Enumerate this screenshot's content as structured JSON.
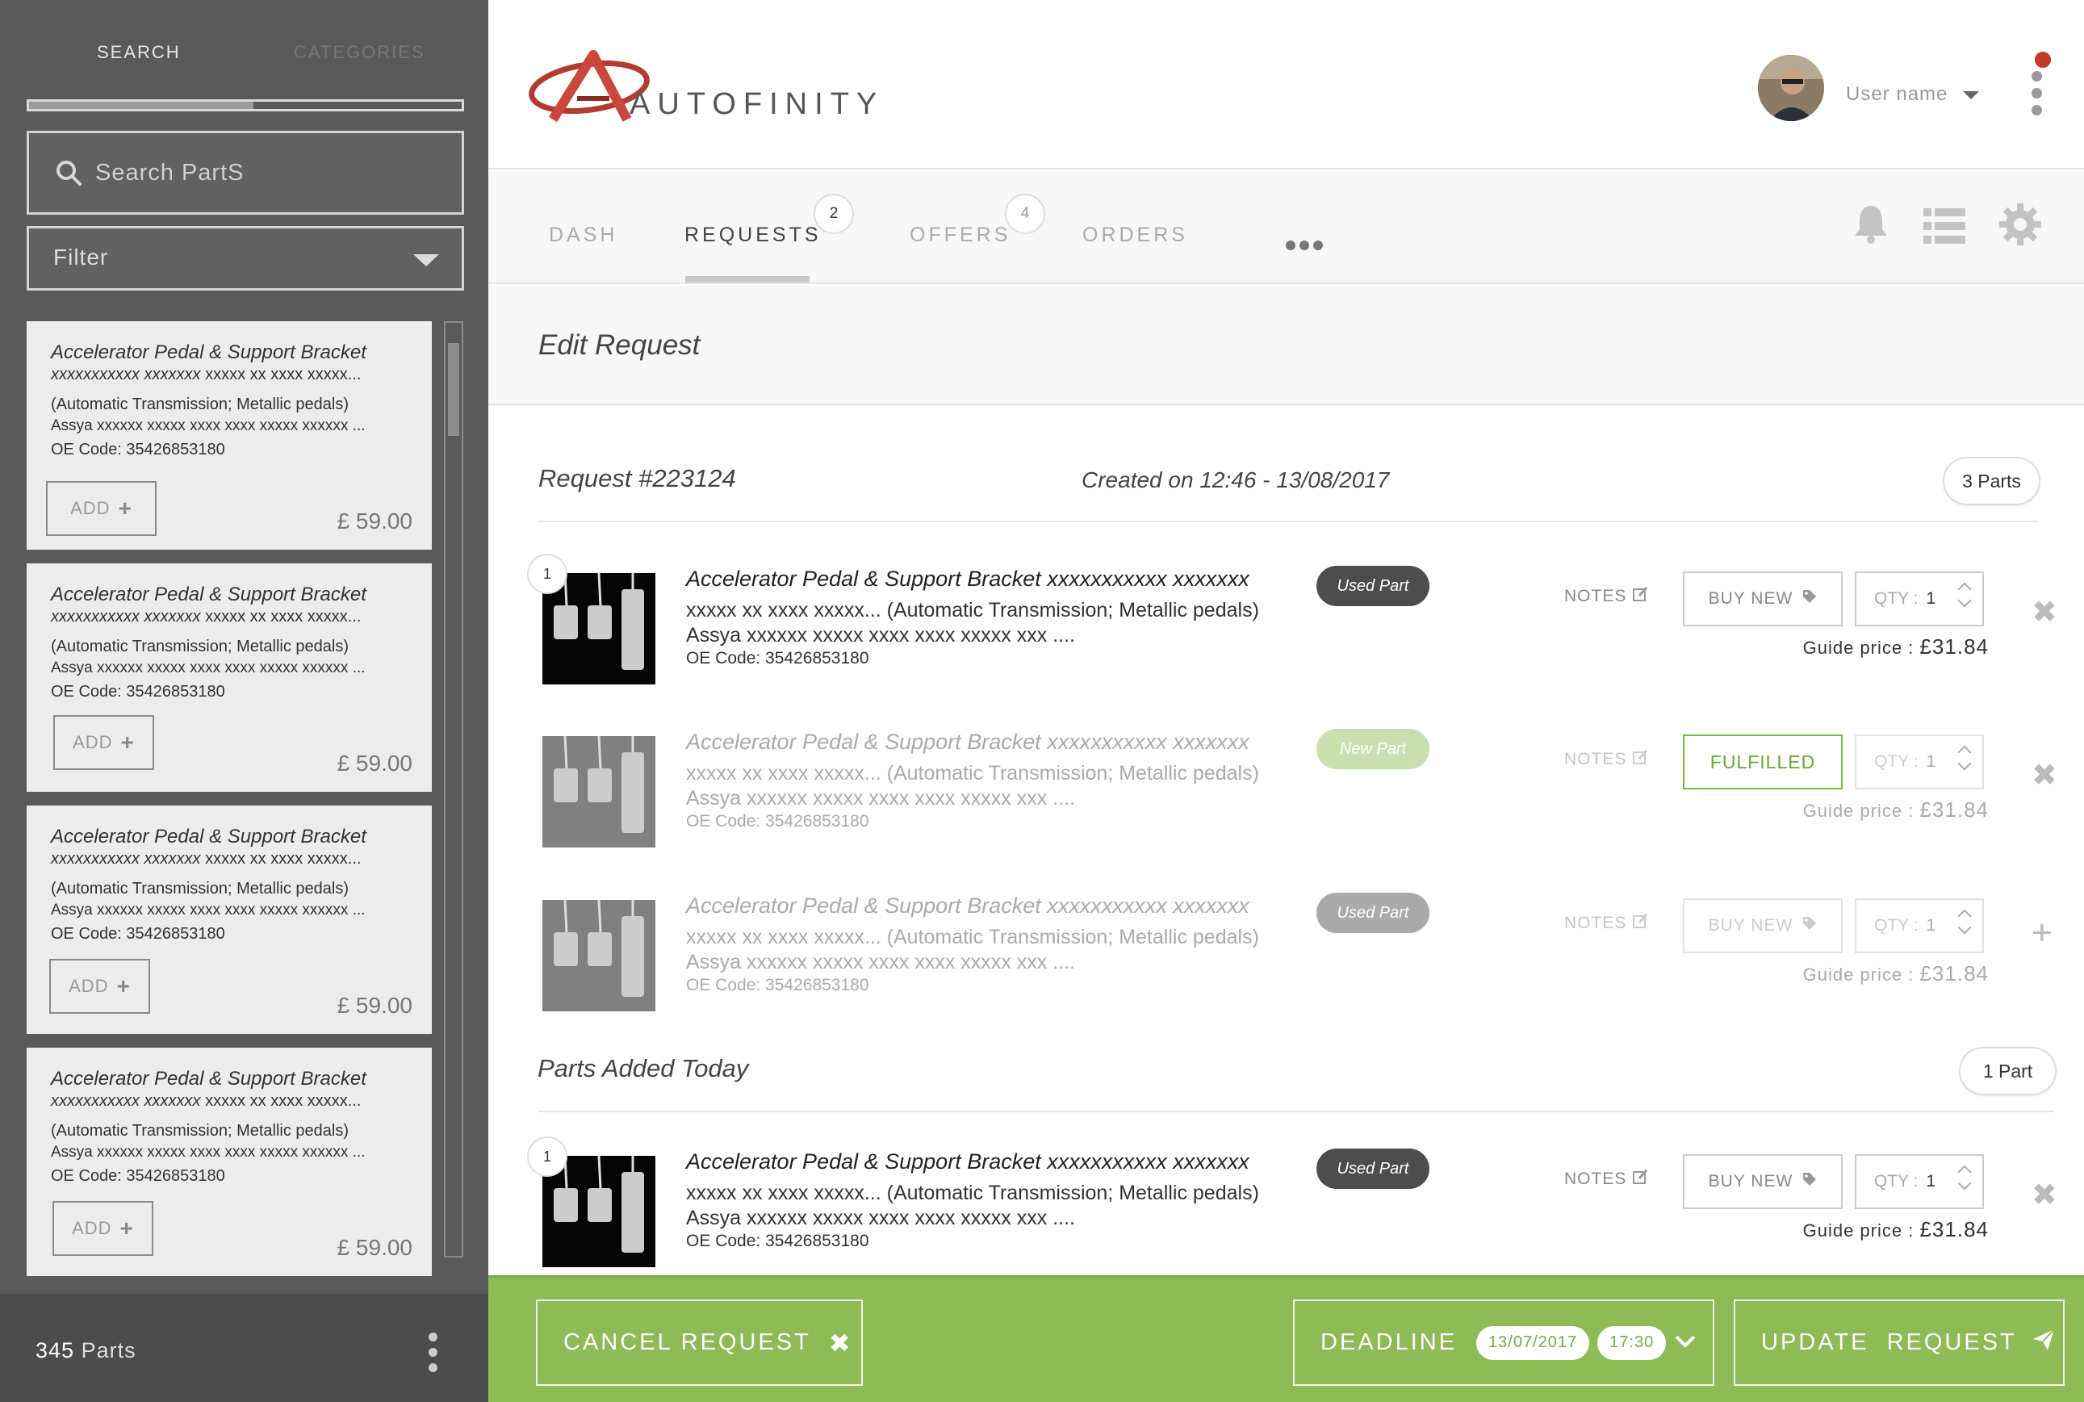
{
  "sidebar": {
    "tabs": {
      "search": "SEARCH",
      "categories": "CATEGORIES"
    },
    "search_placeholder": "Search PartS",
    "filter_label": "Filter",
    "parts": [
      {
        "title": "Accelerator Pedal & Support Bracket",
        "line2_bold": "xxxxxxxxxxx xxxxxxx",
        "line2_rest": " xxxxx xx xxxx xxxxx...",
        "line3": "(Automatic Transmission; Metallic pedals)",
        "line4": "Assya xxxxxx xxxxx xxxx xxxx xxxxx xxxxxx ...",
        "oe": "OE Code: 35426853180",
        "add_label": "ADD",
        "price": "£  59.00"
      },
      {
        "title": "Accelerator Pedal & Support Bracket",
        "line2_bold": "xxxxxxxxxxx xxxxxxx",
        "line2_rest": " xxxxx xx xxxx xxxxx...",
        "line3": "(Automatic Transmission; Metallic pedals)",
        "line4": "Assya xxxxxx xxxxx xxxx xxxx xxxxx xxxxxx ...",
        "oe": "OE Code: 35426853180",
        "add_label": "ADD",
        "price": "£  59.00"
      },
      {
        "title": "Accelerator Pedal & Support Bracket",
        "line2_bold": "xxxxxxxxxxx xxxxxxx",
        "line2_rest": " xxxxx xx xxxx xxxxx...",
        "line3": "(Automatic Transmission; Metallic pedals)",
        "line4": "Assya xxxxxx xxxxx xxxx xxxx xxxxx xxxxxx ...",
        "oe": "OE Code: 35426853180",
        "add_label": "ADD",
        "price": "£  59.00"
      },
      {
        "title": "Accelerator Pedal & Support Bracket",
        "line2_bold": "xxxxxxxxxxx xxxxxxx",
        "line2_rest": " xxxxx xx xxxx xxxxx...",
        "line3": "(Automatic Transmission; Metallic pedals)",
        "line4": "Assya xxxxxx xxxxx xxxx xxxx xxxxx xxxxxx ...",
        "oe": "OE Code: 35426853180",
        "add_label": "ADD",
        "price": "£  59.00"
      }
    ],
    "footer": {
      "count_number": "345",
      "count_label": "Parts"
    }
  },
  "header": {
    "logo_text": "AUTOFINITY",
    "user_name": "User name"
  },
  "nav": {
    "tabs": [
      "DASH",
      "REQUESTS",
      "OFFERS",
      "ORDERS"
    ],
    "badges": {
      "requests": "2",
      "offers": "4"
    }
  },
  "edit": {
    "title": "Edit Request"
  },
  "request": {
    "id": "Request #223124",
    "created": "Created on 12:46 - 13/08/2017",
    "parts_count": "3 Parts",
    "items": [
      {
        "number": "1",
        "name": "Accelerator Pedal & Support Bracket xxxxxxxxxxx xxxxxxx",
        "desc1": "xxxxx xx xxxx xxxxx... (Automatic Transmission; Metallic pedals)",
        "desc2": "Assya xxxxxx xxxxx xxxx xxxx xxxxx xxx ....",
        "oe": "OE Code: 35426853180",
        "badge": "Used Part",
        "notes": "NOTES",
        "action": "BUY NEW",
        "qty_label": "QTY :",
        "qty": "1",
        "guide_label": "Guide price :",
        "guide_price": "£31.84"
      },
      {
        "name": "Accelerator Pedal & Support Bracket xxxxxxxxxxx xxxxxxx",
        "desc1": "xxxxx xx xxxx xxxxx... (Automatic Transmission; Metallic pedals)",
        "desc2": "Assya xxxxxx xxxxx xxxx xxxx xxxxx xxx ....",
        "oe": "OE Code: 35426853180",
        "badge": "New Part",
        "notes": "NOTES",
        "action": "FULFILLED",
        "qty_label": "QTY :",
        "qty": "1",
        "guide_label": "Guide price :",
        "guide_price": "£31.84"
      },
      {
        "name": "Accelerator Pedal & Support Bracket xxxxxxxxxxx xxxxxxx",
        "desc1": "xxxxx xx xxxx xxxxx... (Automatic Transmission; Metallic pedals)",
        "desc2": "Assya xxxxxx xxxxx xxxx xxxx xxxxx xxx ....",
        "oe": "OE Code: 35426853180",
        "badge": "Used Part",
        "notes": "NOTES",
        "action": "BUY NEW",
        "qty_label": "QTY :",
        "qty": "1",
        "guide_label": "Guide price :",
        "guide_price": "£31.84"
      }
    ]
  },
  "today": {
    "title": "Parts Added Today",
    "parts_count": "1 Part",
    "item": {
      "number": "1",
      "name": "Accelerator Pedal & Support Bracket xxxxxxxxxxx xxxxxxx",
      "desc1": "xxxxx xx xxxx xxxxx... (Automatic Transmission; Metallic pedals)",
      "desc2": "Assya xxxxxx xxxxx xxxx xxxx xxxxx xxx ....",
      "oe": "OE Code: 35426853180",
      "badge": "Used Part",
      "notes": "NOTES",
      "action": "BUY NEW",
      "qty_label": "QTY :",
      "qty": "1",
      "guide_label": "Guide price :",
      "guide_price": "£31.84"
    }
  },
  "footer": {
    "cancel_label": "CANCEL REQUEST",
    "deadline_label": "DEADLINE",
    "deadline_date": "13/07/2017",
    "deadline_time": "17:30",
    "update_label": "UPDATE  REQUEST"
  },
  "colors": {
    "accent_green": "#8dbb55",
    "sidebar": "#5a5a5a",
    "notification": "#c0392b"
  },
  "icons": [
    "search-icon",
    "caret-down-icon",
    "plus-icon",
    "kebab-icon",
    "bell-icon",
    "list-icon",
    "gear-icon",
    "edit-icon",
    "tag-icon",
    "close-icon",
    "plus-icon",
    "paper-plane-icon",
    "chevron-down-icon"
  ]
}
